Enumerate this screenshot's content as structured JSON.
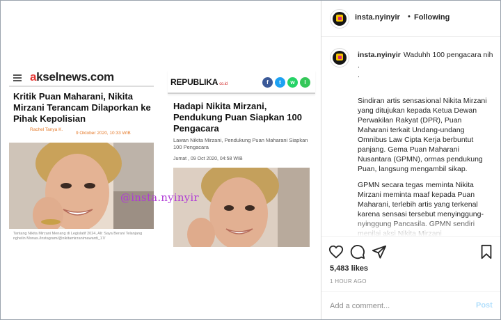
{
  "post": {
    "akselnews": {
      "logo_prefix": "a",
      "logo_rest": "kselnews.com",
      "title": "Kritik Puan Maharani, Nikita Mirzani Terancam Dilaporkan ke Pihak Kepolisian",
      "byline": "Rachel Tanya K.",
      "date": "9 Oktober 2020, 10:33 WIB",
      "caption": "Tantang Nikita Mirzani Menang di Legislatif 2024, Ali: Saya Berani Telanjang nghelin Monas./Instagram/@nikitamirzanimawardi_17/"
    },
    "republika": {
      "logo": "REPUBLIKA",
      "logo_suffix": "co.id",
      "social": [
        "f",
        "t",
        "w",
        "l"
      ],
      "title": "Hadapi Nikita Mirzani, Pendukung Puan Siapkan 100 Pengacara",
      "subtitle": "Lawan Nikita Mirzani, Pendukung Puan Maharani Siapkan 100 Pengacara",
      "date": "Jumat , 09 Oct 2020, 04:58 WIB"
    },
    "watermark": "@insta.nyinyir"
  },
  "header": {
    "username": "insta.nyinyir",
    "separator": "•",
    "follow_label": "Following"
  },
  "caption": {
    "username": "insta.nyinyir",
    "first_line": "Waduhh 100 pengacara nih",
    "dot1": ".",
    "dot2": ".",
    "paragraph1": "Sindiran artis sensasional Nikita Mirzani yang ditujukan kepada Ketua Dewan Perwakilan Rakyat (DPR), Puan Maharani terkait Undang-undang Omnibus Law Cipta Kerja berbuntut panjang. Gema Puan Maharani Nusantara (GPMN), ormas pendukung Puan, langsung mengambil sikap.",
    "paragraph2": "GPMN secara tegas meminta Nikita Mirzani meminta maaf kepada Puan Maharani, terlebih artis yang terkenal karena sensasi tersebut menyinggung-nyinggung Pancasila. GPMN sendiri menilai aksi Nikita Mirzani menunjukkan ketidakpahaman terhadap"
  },
  "actions": {
    "icons": [
      "heart-icon",
      "comment-icon",
      "share-icon",
      "bookmark-icon"
    ]
  },
  "likes": "5,483 likes",
  "time": "1 HOUR AGO",
  "comment": {
    "placeholder": "Add a comment...",
    "post_label": "Post"
  },
  "colors": {
    "instagram_blue_disabled": "#b2dffc",
    "watermark": "#b03ad6",
    "akselnews_red": "#e53935",
    "byline_orange": "#e57a2a"
  }
}
